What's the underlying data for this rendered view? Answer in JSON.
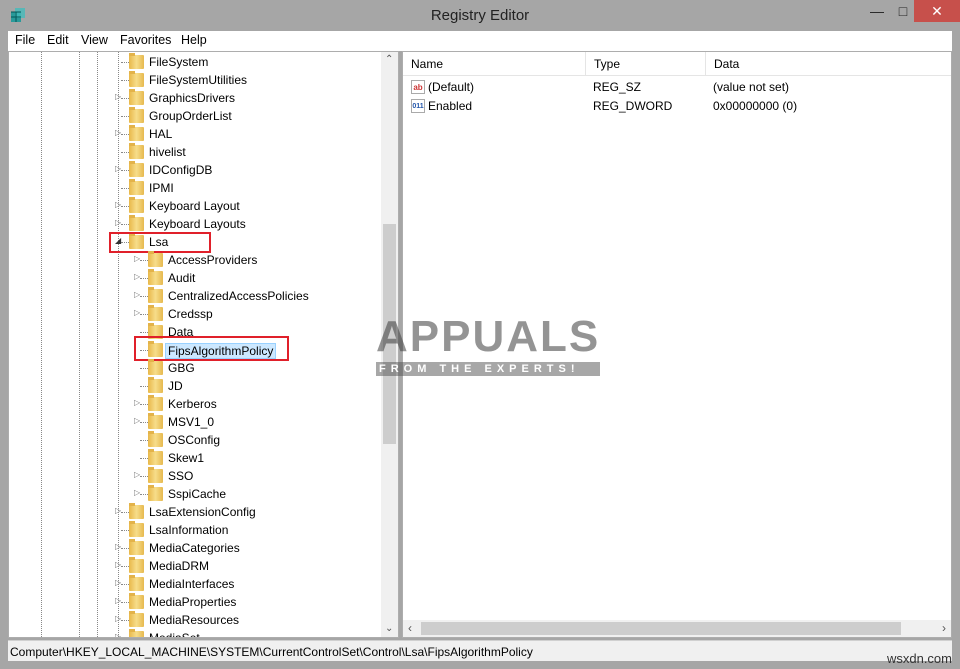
{
  "window": {
    "title": "Registry Editor",
    "icon": "registry-editor-icon"
  },
  "menu": [
    "File",
    "Edit",
    "View",
    "Favorites",
    "Help"
  ],
  "tree": {
    "items": [
      {
        "label": "FileSystem",
        "level": 1,
        "expander": "none"
      },
      {
        "label": "FileSystemUtilities",
        "level": 1,
        "expander": "none"
      },
      {
        "label": "GraphicsDrivers",
        "level": 1,
        "expander": "collapsed"
      },
      {
        "label": "GroupOrderList",
        "level": 1,
        "expander": "none"
      },
      {
        "label": "HAL",
        "level": 1,
        "expander": "collapsed"
      },
      {
        "label": "hivelist",
        "level": 1,
        "expander": "none"
      },
      {
        "label": "IDConfigDB",
        "level": 1,
        "expander": "collapsed"
      },
      {
        "label": "IPMI",
        "level": 1,
        "expander": "none"
      },
      {
        "label": "Keyboard Layout",
        "level": 1,
        "expander": "collapsed"
      },
      {
        "label": "Keyboard Layouts",
        "level": 1,
        "expander": "collapsed"
      },
      {
        "label": "Lsa",
        "level": 1,
        "expander": "expanded",
        "highlighted": true
      },
      {
        "label": "AccessProviders",
        "level": 2,
        "expander": "collapsed"
      },
      {
        "label": "Audit",
        "level": 2,
        "expander": "collapsed"
      },
      {
        "label": "CentralizedAccessPolicies",
        "level": 2,
        "expander": "collapsed"
      },
      {
        "label": "Credssp",
        "level": 2,
        "expander": "collapsed"
      },
      {
        "label": "Data",
        "level": 2,
        "expander": "none"
      },
      {
        "label": "FipsAlgorithmPolicy",
        "level": 2,
        "expander": "none",
        "selected": true,
        "highlighted": true
      },
      {
        "label": "GBG",
        "level": 2,
        "expander": "none"
      },
      {
        "label": "JD",
        "level": 2,
        "expander": "none"
      },
      {
        "label": "Kerberos",
        "level": 2,
        "expander": "collapsed"
      },
      {
        "label": "MSV1_0",
        "level": 2,
        "expander": "collapsed"
      },
      {
        "label": "OSConfig",
        "level": 2,
        "expander": "none"
      },
      {
        "label": "Skew1",
        "level": 2,
        "expander": "none"
      },
      {
        "label": "SSO",
        "level": 2,
        "expander": "collapsed"
      },
      {
        "label": "SspiCache",
        "level": 2,
        "expander": "collapsed"
      },
      {
        "label": "LsaExtensionConfig",
        "level": 1,
        "expander": "collapsed"
      },
      {
        "label": "LsaInformation",
        "level": 1,
        "expander": "none"
      },
      {
        "label": "MediaCategories",
        "level": 1,
        "expander": "collapsed"
      },
      {
        "label": "MediaDRM",
        "level": 1,
        "expander": "collapsed"
      },
      {
        "label": "MediaInterfaces",
        "level": 1,
        "expander": "collapsed"
      },
      {
        "label": "MediaProperties",
        "level": 1,
        "expander": "collapsed"
      },
      {
        "label": "MediaResources",
        "level": 1,
        "expander": "collapsed"
      },
      {
        "label": "MediaSet",
        "level": 1,
        "expander": "collapsed"
      }
    ]
  },
  "values": {
    "columns": [
      "Name",
      "Type",
      "Data"
    ],
    "rows": [
      {
        "icon": "string-value-icon",
        "name": "(Default)",
        "type": "REG_SZ",
        "data": "(value not set)"
      },
      {
        "icon": "binary-value-icon",
        "name": "Enabled",
        "type": "REG_DWORD",
        "data": "0x00000000 (0)"
      }
    ]
  },
  "status": {
    "path": "Computer\\HKEY_LOCAL_MACHINE\\SYSTEM\\CurrentControlSet\\Control\\Lsa\\FipsAlgorithmPolicy"
  },
  "watermark": {
    "logo": "APPUALS",
    "tagline": "FROM THE EXPERTS!",
    "site": "wsxdn.com"
  },
  "colors": {
    "highlight": "#e0202a",
    "selection": "#cce8ff"
  }
}
